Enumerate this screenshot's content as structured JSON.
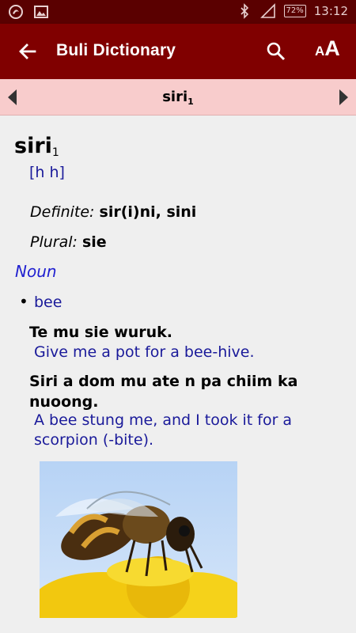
{
  "status": {
    "battery": "72%",
    "time": "13:12"
  },
  "appbar": {
    "title": "Buli Dictionary",
    "font_small": "A",
    "font_big": "A"
  },
  "nav": {
    "word": "siri",
    "homonym": "1"
  },
  "entry": {
    "headword": "siri",
    "homonym": "1",
    "pronunciation": "[h h]",
    "definite_label": "Definite:",
    "definite_value": "sir(i)ni, sini",
    "plural_label": "Plural:",
    "plural_value": "sie",
    "part_of_speech": "Noun",
    "bullet": "•",
    "sense": "bee",
    "examples": [
      {
        "buli": "Te mu sie wuruk.",
        "english": "Give me a pot for a bee-hive."
      },
      {
        "buli": "Siri a dom mu ate n pa chiim ka nuoong.",
        "english": "A bee stung me, and I took it for a scorpion (-bite)."
      }
    ]
  },
  "icons": {
    "back": "arrow-left-icon",
    "search": "search-icon",
    "prev": "triangle-left-icon",
    "next": "triangle-right-icon"
  },
  "colors": {
    "appbar": "#800000",
    "statusbar": "#5a0000",
    "navbar": "#f8cccc",
    "translation": "#1a1a9a",
    "part_of_speech": "#1f1fd0"
  }
}
